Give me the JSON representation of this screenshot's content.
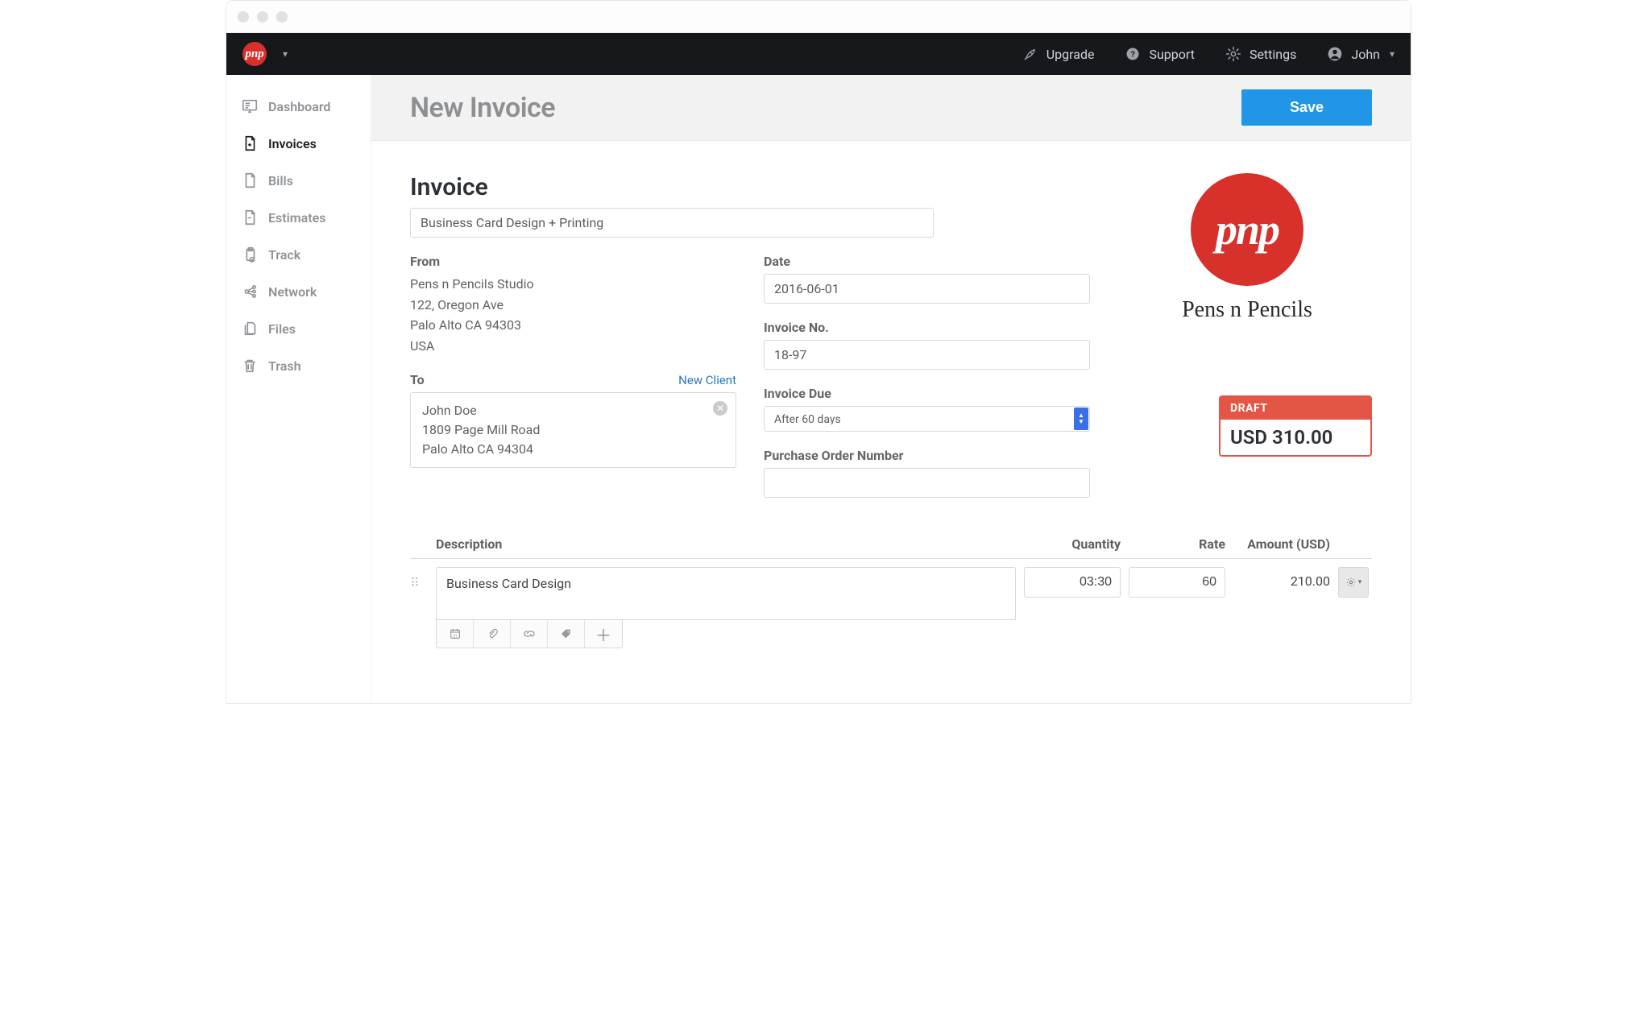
{
  "topbar": {
    "logo_text": "pnp",
    "upgrade": "Upgrade",
    "support": "Support",
    "settings": "Settings",
    "user": "John"
  },
  "sidebar": {
    "items": [
      {
        "label": "Dashboard",
        "icon": "dashboard-icon"
      },
      {
        "label": "Invoices",
        "icon": "invoice-icon",
        "active": true
      },
      {
        "label": "Bills",
        "icon": "bill-icon"
      },
      {
        "label": "Estimates",
        "icon": "estimate-icon"
      },
      {
        "label": "Track",
        "icon": "track-icon"
      },
      {
        "label": "Network",
        "icon": "network-icon"
      },
      {
        "label": "Files",
        "icon": "files-icon"
      },
      {
        "label": "Trash",
        "icon": "trash-icon"
      }
    ]
  },
  "header": {
    "page_title": "New Invoice",
    "save_label": "Save"
  },
  "form": {
    "title_heading": "Invoice",
    "title_value": "Business Card Design + Printing",
    "from_label": "From",
    "from_lines": {
      "l1": "Pens n Pencils Studio",
      "l2": "122, Oregon Ave",
      "l3": "Palo Alto CA 94303",
      "l4": "USA"
    },
    "to_label": "To",
    "new_client": "New Client",
    "to_lines": {
      "l1": "John Doe",
      "l2": "1809 Page Mill Road",
      "l3": "Palo Alto CA 94304"
    },
    "date_label": "Date",
    "date_value": "2016-06-01",
    "invoice_no_label": "Invoice No.",
    "invoice_no_value": "18-97",
    "due_label": "Invoice Due",
    "due_value": "After 60 days",
    "po_label": "Purchase Order Number",
    "po_value": ""
  },
  "brand": {
    "circle_text": "pnp",
    "name": "Pens n Pencils"
  },
  "total_card": {
    "status": "DRAFT",
    "amount": "USD 310.00"
  },
  "line_items": {
    "col_description": "Description",
    "col_quantity": "Quantity",
    "col_rate": "Rate",
    "col_amount": "Amount (USD)",
    "rows": [
      {
        "description": "Business Card Design",
        "quantity": "03:30",
        "rate": "60",
        "amount": "210.00"
      }
    ]
  },
  "colors": {
    "accent_blue": "#2196e6",
    "brand_red": "#d8302a",
    "draft_red": "#e35646"
  }
}
